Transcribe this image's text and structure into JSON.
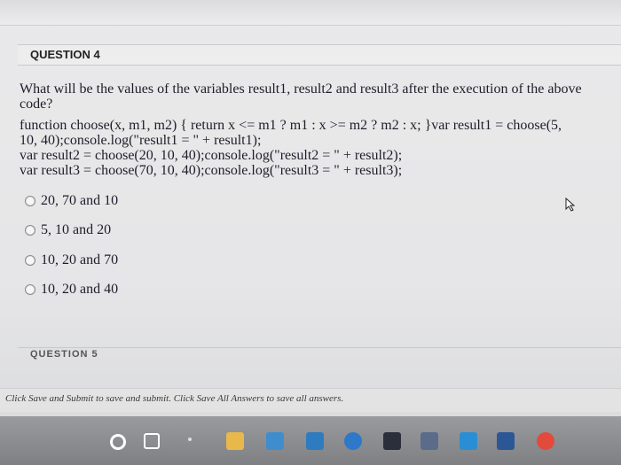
{
  "question": {
    "title": "QUESTION 4",
    "prompt": "What will be the values of the variables result1, result2 and result3 after the execution of the above code?",
    "code_lines": [
      "function choose(x, m1, m2) {  return x <= m1 ? m1 : x >= m2 ? m2 : x; }var result1 = choose(5,",
      "10, 40);console.log(\"result1 = \" + result1);",
      "var result2 = choose(20, 10, 40);console.log(\"result2 = \" + result2);",
      "var result3 = choose(70, 10, 40);console.log(\"result3 = \" + result3);"
    ],
    "options": [
      {
        "label": "20, 70 and 10"
      },
      {
        "label": "5, 10 and 20"
      },
      {
        "label": "10, 20 and 70"
      },
      {
        "label": "10, 20 and 40"
      }
    ]
  },
  "next_question": {
    "title": "QUESTION 5"
  },
  "footer": {
    "instructions": "Click Save and Submit to save and submit. Click Save All Answers to save all answers."
  },
  "taskbar": {
    "items": [
      {
        "icon": "search-circle-icon",
        "color": "#ffffff"
      },
      {
        "icon": "task-view-icon",
        "color": "#ffffff"
      },
      {
        "icon": "file-explorer-icon",
        "color": "#e8b84a"
      },
      {
        "icon": "calculator-icon",
        "color": "#3f8dcc"
      },
      {
        "icon": "mail-icon",
        "color": "#2f7bbf"
      },
      {
        "icon": "edge-icon",
        "color": "#2e78c9"
      },
      {
        "icon": "store-icon",
        "color": "#2a2f3b"
      },
      {
        "icon": "photos-icon",
        "color": "#5a6c8a"
      },
      {
        "icon": "vscode-icon",
        "color": "#2a8ed4"
      },
      {
        "icon": "word-icon",
        "color": "#2b5797"
      },
      {
        "icon": "chrome-icon",
        "color": "#e24b3b"
      }
    ]
  }
}
